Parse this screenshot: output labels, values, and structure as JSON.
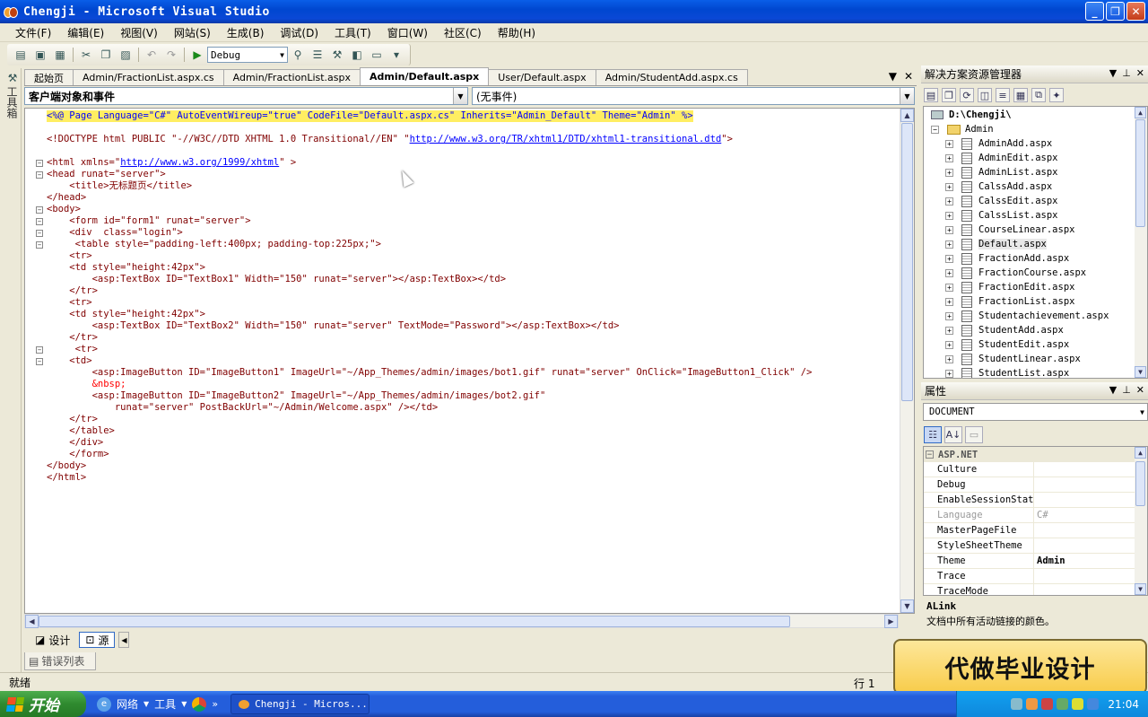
{
  "window": {
    "title": "Chengji - Microsoft Visual Studio"
  },
  "menubar": [
    "文件(F)",
    "编辑(E)",
    "视图(V)",
    "网站(S)",
    "生成(B)",
    "调试(D)",
    "工具(T)",
    "窗口(W)",
    "社区(C)",
    "帮助(H)"
  ],
  "toolbar": {
    "config_value": "Debug"
  },
  "toolbox": {
    "label": "工具箱"
  },
  "doc_tabs": [
    "起始页",
    "Admin/FractionList.aspx.cs",
    "Admin/FractionList.aspx",
    "Admin/Default.aspx",
    "User/Default.aspx",
    "Admin/StudentAdd.aspx.cs"
  ],
  "active_tab_index": 3,
  "nav": {
    "left": "客户端对象和事件",
    "right": "(无事件)"
  },
  "code": {
    "l1": {
      "pre": "<%@ Page Language=\"C#\" AutoEventWireup=\"true\" CodeFile=\"Default.aspx.cs\" Inherits=\"Admin_Default\" Theme=\"Admin\" %>"
    },
    "l2": {
      "a": "<!DOCTYPE html PUBLIC \"-//W3C//DTD XHTML 1.0 Transitional//EN\" \"",
      "link": "http://www.w3.org/TR/xhtml1/DTD/xhtml1-transitional.dtd",
      "b": "\">"
    },
    "l3": {
      "a": "<html xmlns=\"",
      "link": "http://www.w3.org/1999/xhtml",
      "b": "\" >"
    },
    "l4": "<head runat=\"server\">",
    "l5": "    <title>无标题页</title>",
    "l6": "</head>",
    "l7": "<body>",
    "l8": "    <form id=\"form1\" runat=\"server\">",
    "l9": "    <div  class=\"login\">",
    "l10": "     <table style=\"padding-left:400px; padding-top:225px;\">",
    "l11": "    <tr>",
    "l12": "    <td style=\"height:42px\">",
    "l13": "        <asp:TextBox ID=\"TextBox1\" Width=\"150\" runat=\"server\"></asp:TextBox></td>",
    "l14": "    </tr>",
    "l15": "    <tr>",
    "l16": "    <td style=\"height:42px\">",
    "l17": "        <asp:TextBox ID=\"TextBox2\" Width=\"150\" runat=\"server\" TextMode=\"Password\"></asp:TextBox></td>",
    "l18": "    </tr>",
    "l19": "     <tr>",
    "l20": "    <td>",
    "l21": "        <asp:ImageButton ID=\"ImageButton1\" ImageUrl=\"~/App_Themes/admin/images/bot1.gif\" runat=\"server\" OnClick=\"ImageButton1_Click\" />",
    "l22": "        &nbsp;",
    "l23": "        <asp:ImageButton ID=\"ImageButton2\" ImageUrl=\"~/App_Themes/admin/images/bot2.gif\"",
    "l24": "            runat=\"server\" PostBackUrl=\"~/Admin/Welcome.aspx\" /></td>",
    "l25": "    </tr>",
    "l26": "    </table>",
    "l27": "    </div>",
    "l28": "    </form>",
    "l29": "</body>",
    "l30": "</html>"
  },
  "view_tabs": {
    "design": "设计",
    "source": "源"
  },
  "error_tab": "错误列表",
  "status": {
    "ready": "就绪",
    "line": "行 1"
  },
  "solution_explorer": {
    "title": "解决方案资源管理器",
    "root": "D:\\Chengji\\",
    "folder": "Admin",
    "files": [
      "AdminAdd.aspx",
      "AdminEdit.aspx",
      "AdminList.aspx",
      "CalssAdd.aspx",
      "CalssEdit.aspx",
      "CalssList.aspx",
      "CourseLinear.aspx",
      "Default.aspx",
      "FractionAdd.aspx",
      "FractionCourse.aspx",
      "FractionEdit.aspx",
      "FractionList.aspx",
      "Studentachievement.aspx",
      "StudentAdd.aspx",
      "StudentEdit.aspx",
      "StudentLinear.aspx",
      "StudentList.aspx"
    ]
  },
  "properties": {
    "title": "属性",
    "object": "DOCUMENT",
    "category": "ASP.NET",
    "rows": [
      {
        "name": "Culture",
        "value": ""
      },
      {
        "name": "Debug",
        "value": ""
      },
      {
        "name": "EnableSessionState",
        "value": ""
      },
      {
        "name": "Language",
        "value": "C#"
      },
      {
        "name": "MasterPageFile",
        "value": ""
      },
      {
        "name": "StyleSheetTheme",
        "value": ""
      },
      {
        "name": "Theme",
        "value": "Admin"
      },
      {
        "name": "Trace",
        "value": ""
      },
      {
        "name": "TraceMode",
        "value": ""
      }
    ],
    "desc_name": "ALink",
    "desc_text": "文档中所有活动链接的颜色。"
  },
  "taskbar": {
    "start": "开始",
    "ql1": "网络",
    "ql2": "工具",
    "task": "Chengji - Micros...",
    "clock": "21:04"
  },
  "callout": "代做毕业设计"
}
